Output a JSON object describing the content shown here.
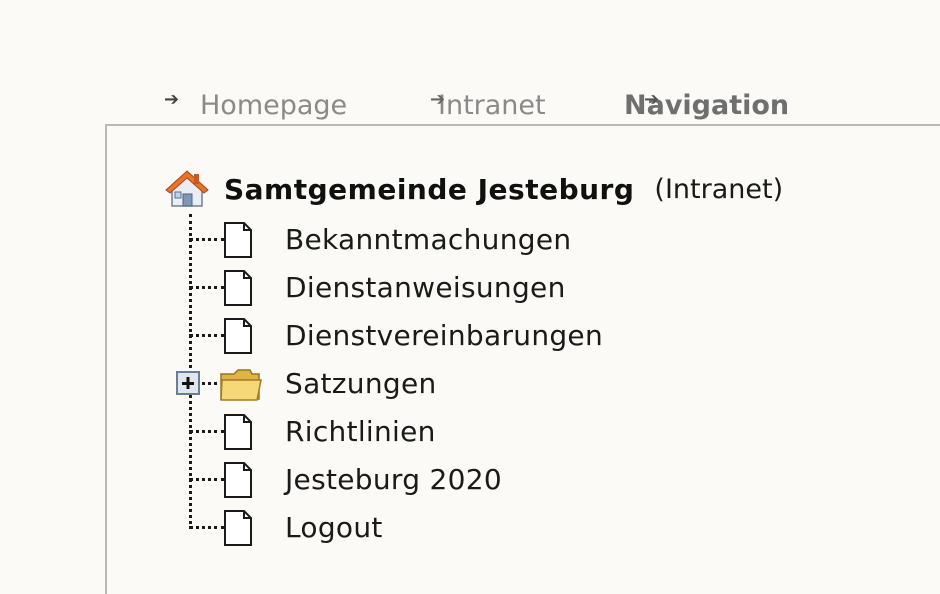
{
  "tabs": {
    "homepage": "Homepage",
    "intranet": "Intranet",
    "navigation": "Navigation",
    "arrow_icon": "arrow-right-icon"
  },
  "tree": {
    "root": {
      "icon": "home-icon",
      "name": "Samtgemeinde Jesteburg",
      "suffix": "(Intranet)"
    },
    "items": [
      {
        "label": "Bekanntmachungen",
        "icon": "document-icon"
      },
      {
        "label": "Dienstanweisungen",
        "icon": "document-icon"
      },
      {
        "label": "Dienstvereinbarungen",
        "icon": "document-icon"
      },
      {
        "label": "Satzungen",
        "icon": "folder-icon",
        "expandable": true,
        "expanded": false
      },
      {
        "label": "Richtlinien",
        "icon": "document-icon"
      },
      {
        "label": "Jesteburg 2020",
        "icon": "document-icon"
      },
      {
        "label": "Logout",
        "icon": "document-icon"
      }
    ]
  },
  "colors": {
    "background": "#fbfaf6",
    "tab_text": "#8a8a8a",
    "text": "#1a1a1a",
    "panel_border": "#b9b9b9",
    "folder": "#f2c94c"
  }
}
